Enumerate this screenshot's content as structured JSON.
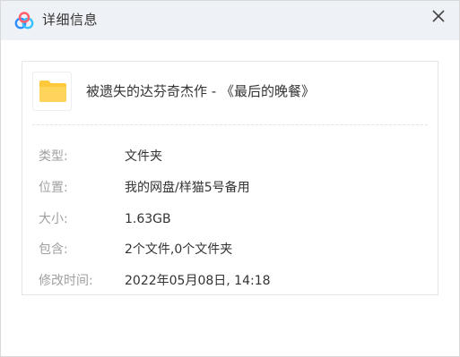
{
  "window": {
    "title": "详细信息",
    "close_glyph": "✕",
    "app_icon": "baidu-netdisk-cloud-icon"
  },
  "file": {
    "icon": "folder-icon",
    "name": "被遗失的达芬奇杰作 - 《最后的晚餐》"
  },
  "details": [
    {
      "key": "type",
      "label": "类型:",
      "value": "文件夹"
    },
    {
      "key": "location",
      "label": "位置:",
      "value": "我的网盘/样猫5号备用"
    },
    {
      "key": "size",
      "label": "大小:",
      "value": "1.63GB"
    },
    {
      "key": "contains",
      "label": "包含:",
      "value": "2个文件,0个文件夹"
    },
    {
      "key": "modified",
      "label": "修改时间:",
      "value": "2022年05月08日, 14:18"
    }
  ],
  "colors": {
    "titlebar_bg": "#eef1f5",
    "folder_yellow": "#ffc93b",
    "label_gray": "#a0a0a0",
    "value_text": "#333333",
    "logo_blue": "#2f8cff"
  }
}
